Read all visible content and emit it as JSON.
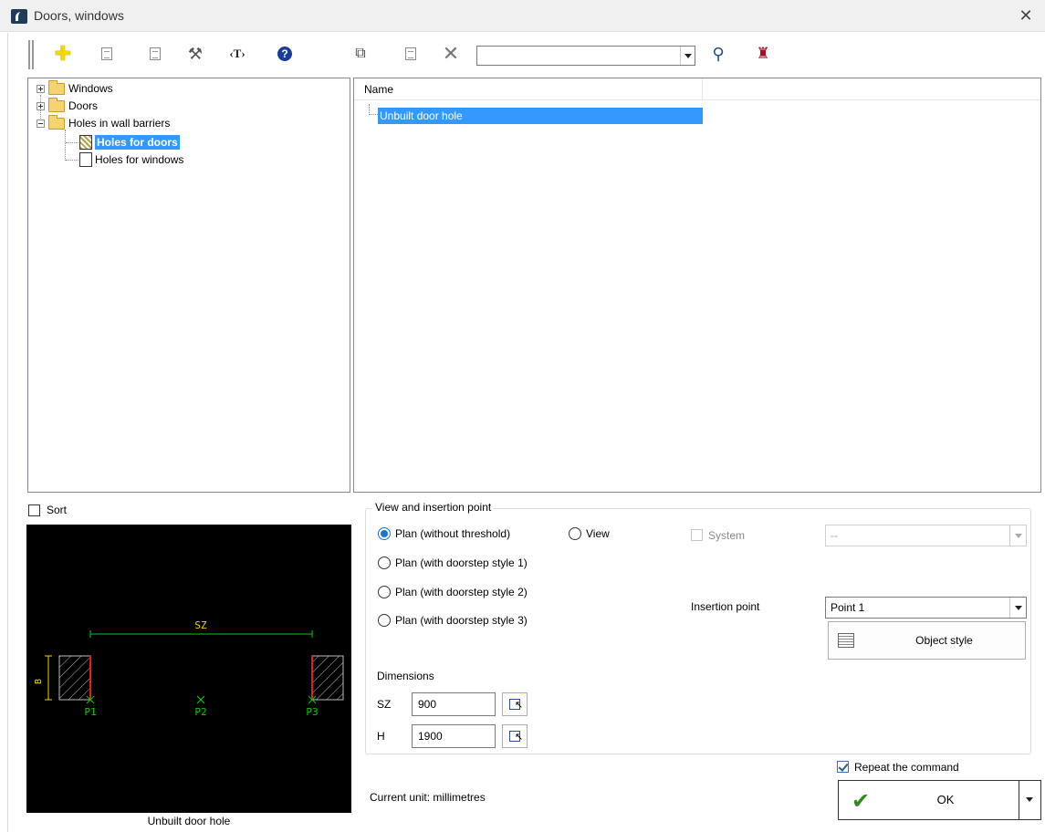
{
  "window": {
    "title": "Doors, windows",
    "close_icon": "✕"
  },
  "toolbar": {
    "icons": [
      "add-icon",
      "properties-icon",
      "edit-icon",
      "tools-icon",
      "text-icon",
      "help-icon",
      "copy-icon",
      "list-icon",
      "delete-icon",
      "search-icon",
      "binoculars-icon"
    ],
    "search_value": ""
  },
  "tree": {
    "items": [
      {
        "label": "Windows",
        "expander": "+"
      },
      {
        "label": "Doors",
        "expander": "+"
      },
      {
        "label": "Holes in wall barriers",
        "expander": "-"
      },
      {
        "label": "Holes for doors",
        "selected": true
      },
      {
        "label": "Holes for windows"
      }
    ]
  },
  "list": {
    "header": {
      "name": "Name"
    },
    "rows": [
      {
        "name": "Unbuilt door hole",
        "selected": true
      }
    ]
  },
  "sort": {
    "label": "Sort",
    "checked": false
  },
  "preview": {
    "caption": "Unbuilt door hole",
    "labels": {
      "sz": "SZ",
      "b": "B",
      "p1": "P1",
      "p2": "P2",
      "p3": "P3"
    }
  },
  "view_insertion": {
    "group_title": "View and insertion point",
    "radios": [
      {
        "label": "Plan (without threshold)",
        "checked": true
      },
      {
        "label": "View",
        "checked": false
      },
      {
        "label": "Plan (with doorstep style 1)",
        "checked": false
      },
      {
        "label": "Plan (with doorstep style 2)",
        "checked": false
      },
      {
        "label": "Plan (with doorstep style 3)",
        "checked": false
      }
    ],
    "system": {
      "label": "System",
      "checked": false,
      "value": "--"
    },
    "insertion_point": {
      "label": "Insertion point",
      "value": "Point 1"
    },
    "object_style_button": "Object style"
  },
  "dimensions": {
    "title": "Dimensions",
    "sz": {
      "label": "SZ",
      "value": "900"
    },
    "h": {
      "label": "H",
      "value": "1900"
    }
  },
  "footer": {
    "current_unit": "Current unit: millimetres",
    "repeat_command": {
      "label": "Repeat the command",
      "checked": true
    },
    "ok_label": "OK"
  },
  "colors": {
    "selection": "#3399ff",
    "preview_bg": "#000000",
    "preview_dim": "#00d000",
    "preview_label": "#e8d800",
    "preview_edge": "#e02020"
  }
}
